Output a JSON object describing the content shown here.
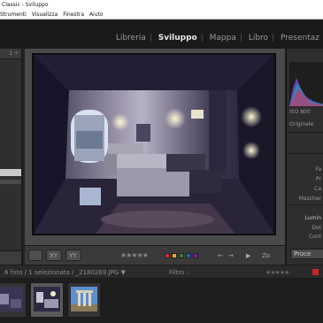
{
  "window": {
    "title": "Classic - Sviluppo"
  },
  "menu": {
    "items": [
      "Strumenti",
      "Visualizza",
      "Finestra",
      "Aiuto"
    ]
  },
  "modules": {
    "items": [
      {
        "label": "Libreria",
        "active": false
      },
      {
        "label": "Sviluppo",
        "active": true
      },
      {
        "label": "Mappa",
        "active": false
      },
      {
        "label": "Libro",
        "active": false
      },
      {
        "label": "Presentaz",
        "active": false
      }
    ],
    "separator": "|"
  },
  "left_panel": {
    "header_value": "1 ÷"
  },
  "toolbar": {
    "view_grid_label": "XY",
    "compare_label": "YY",
    "stars": "★★★★★",
    "zoom_label": "Zo",
    "color_labels": [
      "#d32f2f",
      "#f9a825",
      "#2e7d32",
      "#1565c0",
      "#7b1fa2"
    ],
    "nav_prev": "←",
    "nav_next": "→",
    "play_label": "▶"
  },
  "right_panel": {
    "iso_label": "ISO 800",
    "original_label": "Originale",
    "labels": [
      "Fa",
      "Pr",
      "Ca",
      "Mascher"
    ],
    "section_title": "Lumin",
    "section_sub": [
      "Det",
      "Cont"
    ],
    "button_label": "Proce"
  },
  "filmstrip_header": {
    "info": "6 foto / 1 selezionata / _2180269.JPG",
    "dropdown_arrow": "▼",
    "filter_label": "Filtro :",
    "stars": "★★★★★"
  },
  "filmstrip": {
    "thumbs": [
      {
        "label": "thumb-1",
        "selected": false
      },
      {
        "label": "thumb-2",
        "selected": true
      },
      {
        "label": "thumb-3",
        "selected": false
      }
    ]
  }
}
